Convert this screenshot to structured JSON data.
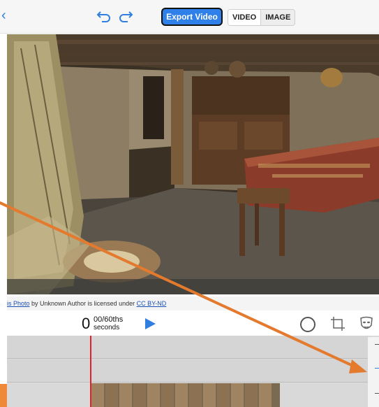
{
  "toolbar": {
    "export_label": "Export Video",
    "mode_options": [
      "VIDEO",
      "IMAGE"
    ],
    "selected_mode": "VIDEO"
  },
  "credit": {
    "prefix": "is Photo",
    "middle": " by Unknown Author is licensed under ",
    "license": "CC BY-ND"
  },
  "player": {
    "time_whole": "0",
    "time_fraction": "00/60ths",
    "time_unit": "seconds"
  },
  "colors": {
    "accent": "#2f80e8",
    "playhead": "#e0202a",
    "annotation_arrow": "#e37a2e"
  }
}
